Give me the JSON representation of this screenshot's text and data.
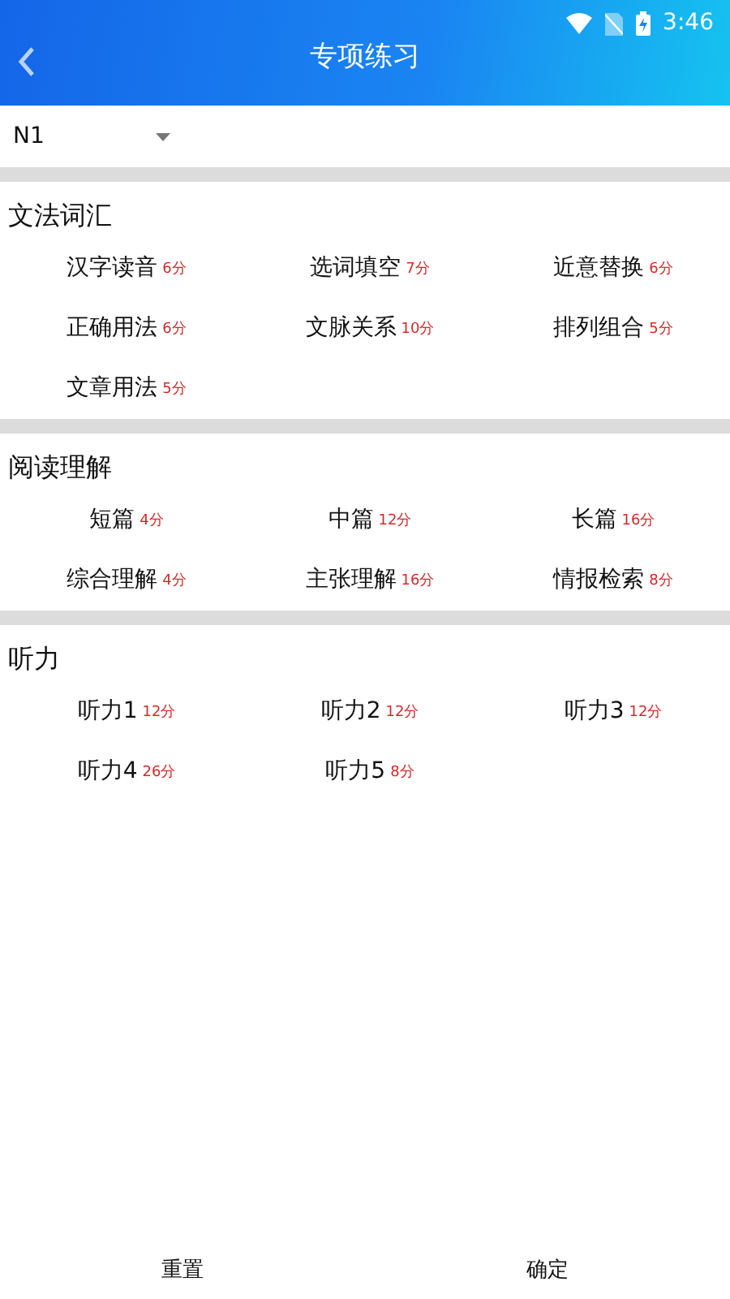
{
  "status_bar": {
    "time": "3:46"
  },
  "header": {
    "title": "专项练习"
  },
  "level_select": {
    "value": "N1"
  },
  "sections": [
    {
      "title": "文法词汇",
      "items": [
        {
          "label": "汉字读音",
          "score": "6分"
        },
        {
          "label": "选词填空",
          "score": "7分"
        },
        {
          "label": "近意替换",
          "score": "6分"
        },
        {
          "label": "正确用法",
          "score": "6分"
        },
        {
          "label": "文脉关系",
          "score": "10分"
        },
        {
          "label": "排列组合",
          "score": "5分"
        },
        {
          "label": "文章用法",
          "score": "5分"
        }
      ]
    },
    {
      "title": "阅读理解",
      "items": [
        {
          "label": "短篇",
          "score": "4分"
        },
        {
          "label": "中篇",
          "score": "12分"
        },
        {
          "label": "长篇",
          "score": "16分"
        },
        {
          "label": "综合理解",
          "score": "4分"
        },
        {
          "label": "主张理解",
          "score": "16分"
        },
        {
          "label": "情报检索",
          "score": "8分"
        }
      ]
    },
    {
      "title": "听力",
      "items": [
        {
          "label": "听力1",
          "score": "12分"
        },
        {
          "label": "听力2",
          "score": "12分"
        },
        {
          "label": "听力3",
          "score": "12分"
        },
        {
          "label": "听力4",
          "score": "26分"
        },
        {
          "label": "听力5",
          "score": "8分"
        }
      ]
    }
  ],
  "footer_buttons": [
    "重置",
    "确定"
  ]
}
